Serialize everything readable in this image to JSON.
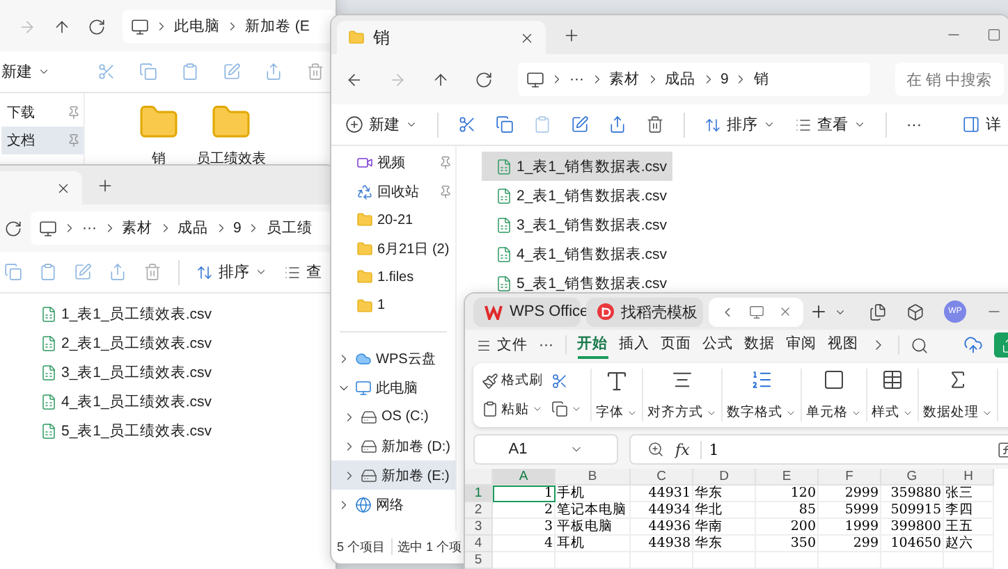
{
  "back_explorer": {
    "address": [
      "此电脑",
      "新加卷 (E"
    ],
    "new_button": "新建",
    "sidebar": [
      {
        "label": "下载",
        "selected": false,
        "pinned": true
      },
      {
        "label": "文档",
        "selected": true,
        "pinned": true
      }
    ],
    "folders": [
      {
        "name": "销"
      },
      {
        "name": "员工绩效表"
      }
    ]
  },
  "files_explorer": {
    "address": [
      "···",
      "素材",
      "成品",
      "9",
      "员工绩"
    ],
    "sort_button": "排序",
    "view_button": "查",
    "files": [
      {
        "name": "1_表1_员工绩效表.csv",
        "selected": false
      },
      {
        "name": "2_表1_员工绩效表.csv",
        "selected": false
      },
      {
        "name": "3_表1_员工绩效表.csv",
        "selected": false
      },
      {
        "name": "4_表1_员工绩效表.csv",
        "selected": false
      },
      {
        "name": "5_表1_员工绩效表.csv",
        "selected": false
      }
    ]
  },
  "sales_explorer": {
    "tab": {
      "title": "销"
    },
    "address": [
      "···",
      "素材",
      "成品",
      "9",
      "销"
    ],
    "search": {
      "placeholder": "在 销 中搜索"
    },
    "toolbar": {
      "new_button": "新建",
      "sort_button": "排序",
      "view_button": "查看",
      "more_button": "···",
      "details_button": "详"
    },
    "quick_access": [
      {
        "label": "视频",
        "kind": "video",
        "pinned": true,
        "selected": false
      },
      {
        "label": "回收站",
        "kind": "recycle",
        "pinned": true,
        "selected": false
      },
      {
        "label": "20-21",
        "kind": "folder",
        "pinned": false,
        "selected": false
      },
      {
        "label": "6月21日 (2)",
        "kind": "folder",
        "pinned": false,
        "selected": false
      },
      {
        "label": "1.files",
        "kind": "folder",
        "pinned": false,
        "selected": false
      },
      {
        "label": "1",
        "kind": "folder",
        "pinned": false,
        "selected": false
      }
    ],
    "locations": [
      {
        "label": "WPS云盘",
        "kind": "cloud",
        "expanded": false,
        "selected": false
      },
      {
        "label": "此电脑",
        "kind": "computer",
        "expanded": true,
        "selected": false,
        "children": [
          {
            "label": "OS (C:)",
            "kind": "drive",
            "expanded": false,
            "selected": false
          },
          {
            "label": "新加卷 (D:)",
            "kind": "drive",
            "expanded": false,
            "selected": false
          },
          {
            "label": "新加卷 (E:)",
            "kind": "drive",
            "expanded": false,
            "selected": true
          }
        ]
      },
      {
        "label": "网络",
        "kind": "network",
        "expanded": false,
        "selected": false
      }
    ],
    "files": [
      {
        "name": "1_表1_销售数据表.csv",
        "selected": true
      },
      {
        "name": "2_表1_销售数据表.csv",
        "selected": false
      },
      {
        "name": "3_表1_销售数据表.csv",
        "selected": false
      },
      {
        "name": "4_表1_销售数据表.csv",
        "selected": false
      },
      {
        "name": "5_表1_销售数据表.csv",
        "selected": false
      }
    ],
    "status_bar": {
      "count": "5 个项目",
      "selection": "选中 1 个项"
    }
  },
  "spreadsheet": {
    "tabs": [
      {
        "label": "WPS Office",
        "kind": "home",
        "selected": false
      },
      {
        "label": "找稻壳模板",
        "kind": "template",
        "selected": false
      },
      {
        "kind": "document",
        "selected": true
      }
    ],
    "avatar": "WP",
    "menu": {
      "file": "文件",
      "more": "···",
      "tabs": [
        {
          "label": "开始",
          "selected": true
        },
        {
          "label": "插入",
          "selected": false
        },
        {
          "label": "页面",
          "selected": false
        },
        {
          "label": "公式",
          "selected": false
        },
        {
          "label": "数据",
          "selected": false
        },
        {
          "label": "审阅",
          "selected": false
        },
        {
          "label": "视图",
          "selected": false
        }
      ]
    },
    "ribbon": {
      "format_painter": "格式刷",
      "paste": "粘贴",
      "groups": [
        {
          "label": "字体",
          "kind": "font"
        },
        {
          "label": "对齐方式",
          "kind": "align"
        },
        {
          "label": "数字格式",
          "kind": "number"
        },
        {
          "label": "单元格",
          "kind": "cell"
        },
        {
          "label": "样式",
          "kind": "style"
        },
        {
          "label": "数据处理",
          "kind": "data"
        }
      ]
    },
    "name_box": "A1",
    "function_label": "fx",
    "formula": "1",
    "columns": [
      {
        "label": "A",
        "kind": "number",
        "selected": true
      },
      {
        "label": "B",
        "kind": "text",
        "selected": false
      },
      {
        "label": "C",
        "kind": "number",
        "selected": false
      },
      {
        "label": "D",
        "kind": "text",
        "selected": false
      },
      {
        "label": "E",
        "kind": "number",
        "selected": false
      },
      {
        "label": "F",
        "kind": "number",
        "selected": false
      },
      {
        "label": "G",
        "kind": "number",
        "selected": false
      },
      {
        "label": "H",
        "kind": "text",
        "selected": false
      }
    ],
    "rows": [
      {
        "number": "1",
        "selected": true,
        "cells": [
          "1",
          "手机",
          "44931",
          "华东",
          "120",
          "2999",
          "359880",
          "张三"
        ]
      },
      {
        "number": "2",
        "selected": false,
        "cells": [
          "2",
          "笔记本电脑",
          "44934",
          "华北",
          "85",
          "5999",
          "509915",
          "李四"
        ]
      },
      {
        "number": "3",
        "selected": false,
        "cells": [
          "3",
          "平板电脑",
          "44936",
          "华南",
          "200",
          "1999",
          "399800",
          "王五"
        ]
      },
      {
        "number": "4",
        "selected": false,
        "cells": [
          "4",
          "耳机",
          "44938",
          "华东",
          "350",
          "299",
          "104650",
          "赵六"
        ]
      },
      {
        "number": "5",
        "selected": false
      }
    ]
  }
}
